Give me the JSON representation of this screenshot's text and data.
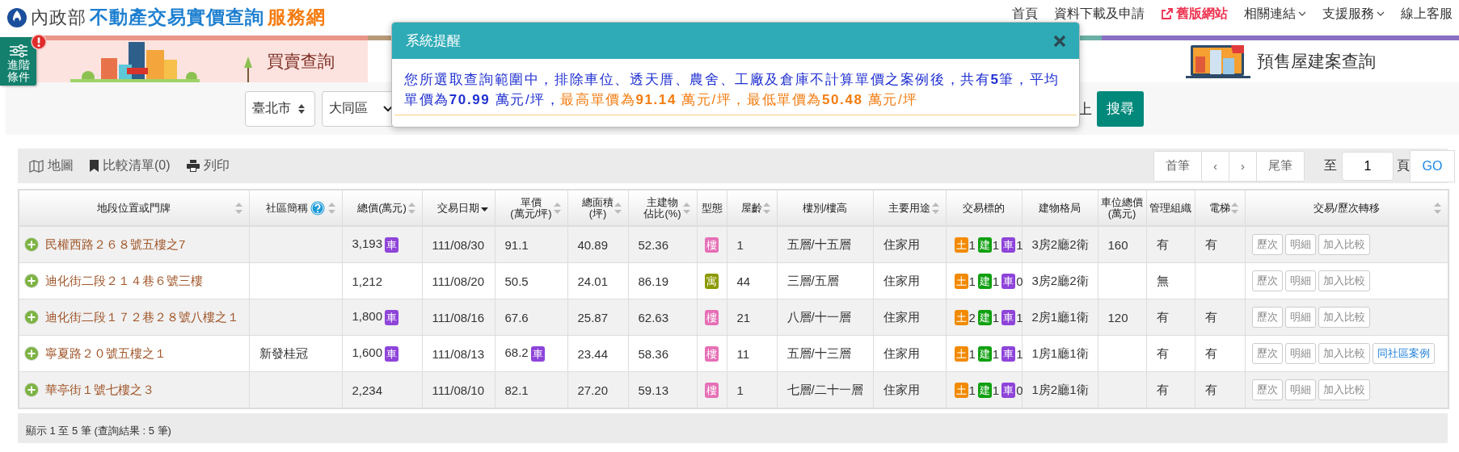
{
  "header": {
    "logo_text": "內政部",
    "title": "不動產交易實價查詢",
    "title_suffix": "服務網",
    "nav": [
      {
        "label": "首頁",
        "kind": "link"
      },
      {
        "label": "資料下載及申請",
        "kind": "link"
      },
      {
        "label": "舊版網站",
        "kind": "external"
      },
      {
        "label": "相關連結",
        "kind": "dropdown"
      },
      {
        "label": "支援服務",
        "kind": "dropdown"
      },
      {
        "label": "線上客服",
        "kind": "link"
      }
    ]
  },
  "advanced_button": {
    "label": "進階條件"
  },
  "tabs": [
    {
      "label": "買賣查詢",
      "selected": true,
      "color": "#e8968a"
    },
    {
      "label": "預售屋建案查詢",
      "selected": false,
      "color": "#8a6fc2"
    }
  ],
  "search": {
    "selects": [
      {
        "value": "臺北市",
        "kind": "spinner"
      },
      {
        "value": "大同區",
        "kind": "chevron"
      }
    ],
    "trailing_text": "上",
    "button": "搜尋"
  },
  "toolbar": {
    "items": [
      {
        "label": "地圖",
        "kind": "map"
      },
      {
        "label": "比較清單(0)",
        "kind": "bookmark"
      },
      {
        "label": "列印",
        "kind": "print"
      }
    ]
  },
  "pagination": {
    "first": "首筆",
    "prev": "‹",
    "next": "›",
    "last": "尾筆",
    "to": "至",
    "page": "1",
    "unit": "頁",
    "go": "GO"
  },
  "table": {
    "columns": [
      {
        "lines": [
          "地段位置或門牌"
        ],
        "sortable": true,
        "sorted": false
      },
      {
        "lines": [
          "社區簡稱"
        ],
        "sortable": true,
        "sorted": false,
        "help": true
      },
      {
        "lines": [
          "總價(萬元)"
        ],
        "sortable": true,
        "sorted": false
      },
      {
        "lines": [
          "交易日期"
        ],
        "sortable": true,
        "sorted": true
      },
      {
        "lines": [
          "單價",
          "(萬元/坪)"
        ],
        "sortable": true,
        "sorted": false
      },
      {
        "lines": [
          "總面積",
          "(坪)"
        ],
        "sortable": true,
        "sorted": false
      },
      {
        "lines": [
          "主建物",
          "佔比(%)"
        ],
        "sortable": true,
        "sorted": false
      },
      {
        "lines": [
          "型態"
        ],
        "sortable": false
      },
      {
        "lines": [
          "屋齡"
        ],
        "sortable": true,
        "sorted": false
      },
      {
        "lines": [
          "樓別/樓高"
        ],
        "sortable": false
      },
      {
        "lines": [
          "主要用途"
        ],
        "sortable": true,
        "sorted": false
      },
      {
        "lines": [
          "交易標的"
        ],
        "sortable": false
      },
      {
        "lines": [
          "建物格局"
        ],
        "sortable": false
      },
      {
        "lines": [
          "車位總價",
          "(萬元)"
        ],
        "sortable": false
      },
      {
        "lines": [
          "管理組織"
        ],
        "sortable": false
      },
      {
        "lines": [
          "電梯"
        ],
        "sortable": true,
        "sorted": false
      },
      {
        "lines": [
          "交易/歷次轉移"
        ],
        "sortable": true,
        "sorted": false
      }
    ],
    "rows": [
      {
        "address": "民權西路２６８號五樓之7",
        "total": "3,193",
        "total_tag": "車",
        "date": "111/08/30",
        "unit_price": "91.1",
        "area": "40.89",
        "ratio": "52.36",
        "type": {
          "label": "樓",
          "color": "#e66fb5"
        },
        "age": "1",
        "floor": "五層/十五層",
        "use": "住家用",
        "subjects": [
          {
            "label": "土",
            "count": "1",
            "color": "#f28a00"
          },
          {
            "label": "建",
            "count": "1",
            "color": "#10a010"
          },
          {
            "label": "車",
            "count": "1",
            "color": "#8e44d9"
          }
        ],
        "layout": "3房2廳2衛",
        "parking_price": "160",
        "management": "有",
        "elevator": "有",
        "actions": [
          {
            "label": "歷次",
            "kind": "plain"
          },
          {
            "label": "明細",
            "kind": "plain"
          },
          {
            "label": "加入比較",
            "kind": "plain"
          }
        ]
      },
      {
        "address": "迪化街二段２１４巷６號三樓",
        "total": "1,212",
        "date": "111/08/20",
        "unit_price": "50.5",
        "area": "24.01",
        "ratio": "86.19",
        "type": {
          "label": "寓",
          "color": "#8c9a00"
        },
        "age": "44",
        "floor": "三層/五層",
        "use": "住家用",
        "subjects": [
          {
            "label": "土",
            "count": "1",
            "color": "#f28a00"
          },
          {
            "label": "建",
            "count": "1",
            "color": "#10a010"
          },
          {
            "label": "車",
            "count": "0",
            "color": "#8e44d9"
          }
        ],
        "layout": "3房2廳2衛",
        "management": "無",
        "actions": [
          {
            "label": "歷次",
            "kind": "plain"
          },
          {
            "label": "明細",
            "kind": "plain"
          },
          {
            "label": "加入比較",
            "kind": "plain"
          }
        ]
      },
      {
        "address": "迪化街二段１７２巷２８號八樓之１",
        "total": "1,800",
        "total_tag": "車",
        "date": "111/08/16",
        "unit_price": "67.6",
        "area": "25.87",
        "ratio": "62.63",
        "type": {
          "label": "樓",
          "color": "#e66fb5"
        },
        "age": "21",
        "floor": "八層/十一層",
        "use": "住家用",
        "subjects": [
          {
            "label": "土",
            "count": "2",
            "color": "#f28a00"
          },
          {
            "label": "建",
            "count": "1",
            "color": "#10a010"
          },
          {
            "label": "車",
            "count": "1",
            "color": "#8e44d9"
          }
        ],
        "layout": "2房1廳1衛",
        "parking_price": "120",
        "management": "有",
        "elevator": "有",
        "actions": [
          {
            "label": "歷次",
            "kind": "plain"
          },
          {
            "label": "明細",
            "kind": "plain"
          },
          {
            "label": "加入比較",
            "kind": "plain"
          }
        ]
      },
      {
        "address": "寧夏路２０號五樓之１",
        "community": "新發桂冠",
        "total": "1,600",
        "total_tag": "車",
        "date": "111/08/13",
        "unit_price": "68.2",
        "unit_tag": "車",
        "area": "23.44",
        "ratio": "58.36",
        "type": {
          "label": "樓",
          "color": "#e66fb5"
        },
        "age": "11",
        "floor": "五層/十三層",
        "use": "住家用",
        "subjects": [
          {
            "label": "土",
            "count": "1",
            "color": "#f28a00"
          },
          {
            "label": "建",
            "count": "1",
            "color": "#10a010"
          },
          {
            "label": "車",
            "count": "1",
            "color": "#8e44d9"
          }
        ],
        "layout": "1房1廳1衛",
        "management": "有",
        "elevator": "有",
        "actions": [
          {
            "label": "歷次",
            "kind": "plain"
          },
          {
            "label": "明細",
            "kind": "plain"
          },
          {
            "label": "加入比較",
            "kind": "plain"
          },
          {
            "label": "同社區案例",
            "kind": "link"
          }
        ]
      },
      {
        "address": "華亭街１號七樓之３",
        "total": "2,234",
        "date": "111/08/10",
        "unit_price": "82.1",
        "area": "27.20",
        "ratio": "59.13",
        "type": {
          "label": "樓",
          "color": "#e66fb5"
        },
        "age": "1",
        "floor": "七層/二十一層",
        "use": "住家用",
        "subjects": [
          {
            "label": "土",
            "count": "1",
            "color": "#f28a00"
          },
          {
            "label": "建",
            "count": "1",
            "color": "#10a010"
          },
          {
            "label": "車",
            "count": "0",
            "color": "#8e44d9"
          }
        ],
        "layout": "1房2廳1衛",
        "management": "有",
        "elevator": "有",
        "actions": [
          {
            "label": "歷次",
            "kind": "plain"
          },
          {
            "label": "明細",
            "kind": "plain"
          },
          {
            "label": "加入比較",
            "kind": "plain"
          }
        ]
      }
    ]
  },
  "footer": {
    "summary": "顯示 1 至 5 筆 (查詢結果 : 5 筆)"
  },
  "alert": {
    "title": "系統提醒",
    "parts": [
      {
        "highlight": false,
        "text": "您所選取查詢範圍中，排除車位、透天厝、農舍、工廠及倉庫不計算單價之案例後，共有**5**筆，平均單價為**70.99** 萬元/坪，"
      },
      {
        "highlight": true,
        "text": "最高單價為**91.14** 萬元/坪，最低單價為**50.48** 萬元/坪"
      }
    ]
  }
}
